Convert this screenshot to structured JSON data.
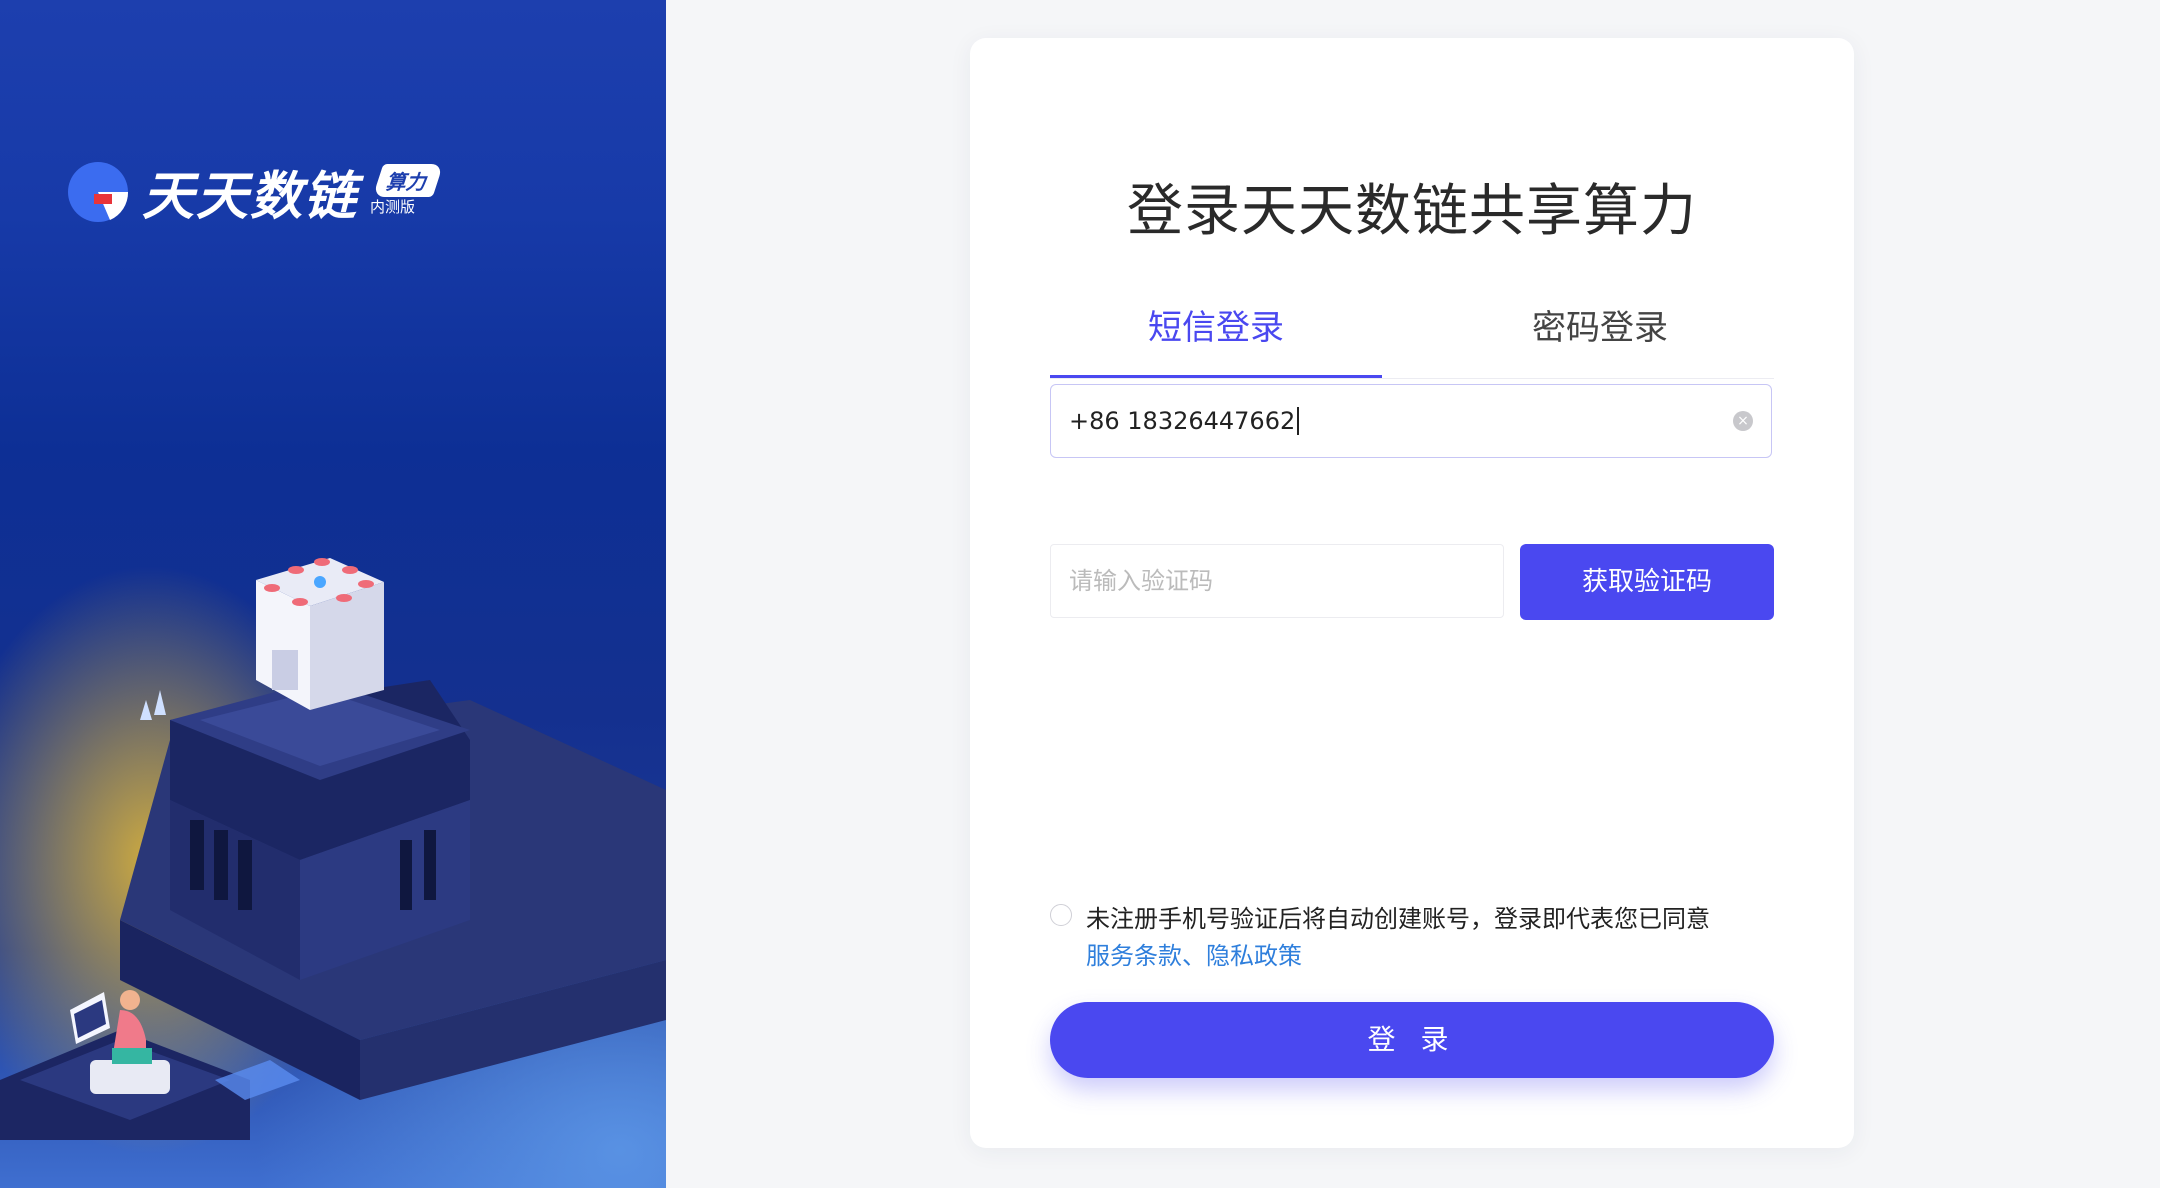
{
  "brand": {
    "name": "天天数链",
    "badge": "算力",
    "badge_sub": "内测版"
  },
  "login": {
    "title": "登录天天数链共享算力",
    "tabs": [
      {
        "label": "短信登录",
        "active": true
      },
      {
        "label": "密码登录",
        "active": false
      }
    ],
    "phone_value": "+86 18326447662",
    "code_placeholder": "请输入验证码",
    "get_code_label": "获取验证码",
    "agreement_text": "未注册手机号验证后将自动创建账号，登录即代表您已同意",
    "agreement_links": "服务条款、隐私政策",
    "submit_label": "登 录"
  },
  "colors": {
    "accent": "#4a48f0",
    "link": "#2f7fdc",
    "hero_blue": "#1d3fae"
  }
}
